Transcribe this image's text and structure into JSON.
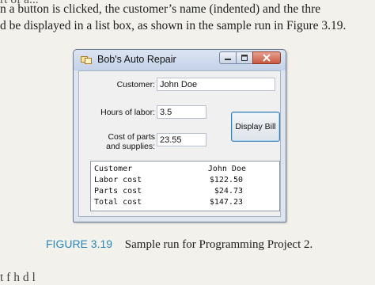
{
  "page": {
    "line_top": "rt of a...",
    "line1": "n a button is clicked, the customer’s name (indented) and the thre",
    "line2": "d be displayed in a list box, as shown in the sample run in Figure 3.19.",
    "line_bottom": "t f   h   d      l"
  },
  "window": {
    "title": "Bob's Auto Repair",
    "labels": {
      "customer": "Customer:",
      "hours": "Hours of labor:",
      "parts_line1": "Cost of parts",
      "parts_line2": "and supplies:"
    },
    "fields": {
      "customer": "John Doe",
      "hours": "3.5",
      "parts": "23.55"
    },
    "button_label": "Display Bill",
    "list": [
      {
        "label": "Customer",
        "value": "John Doe"
      },
      {
        "label": "Labor cost",
        "value": "$122.50"
      },
      {
        "label": "Parts cost",
        "value": "$24.73"
      },
      {
        "label": "Total cost",
        "value": "$147.23"
      }
    ]
  },
  "caption": {
    "label": "FIGURE 3.19",
    "text": "Sample run for Programming Project 2."
  },
  "colors": {
    "figure_label": "#2a86b8",
    "close_button": "#c85a41"
  }
}
